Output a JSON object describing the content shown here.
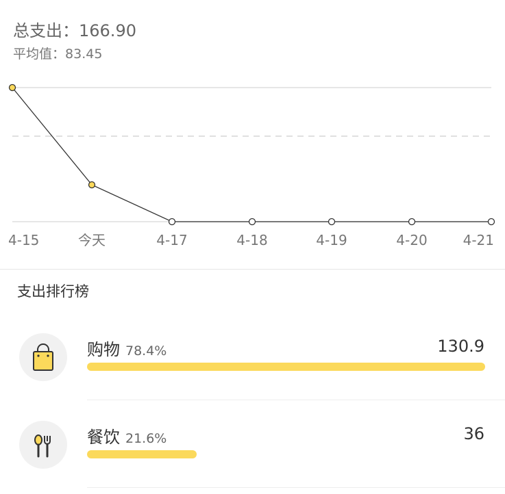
{
  "summary": {
    "total_label": "总支出：",
    "total_value": "166.90",
    "avg_label": "平均值：",
    "avg_value": "83.45"
  },
  "chart_data": {
    "type": "line",
    "categories": [
      "4-15",
      "今天",
      "4-17",
      "4-18",
      "4-19",
      "4-20",
      "4-21"
    ],
    "values": [
      130.9,
      36,
      0,
      0,
      0,
      0,
      0
    ],
    "title": "",
    "xlabel": "",
    "ylabel": "",
    "ylim": [
      0,
      130.9
    ],
    "reference_line": 83.45,
    "point_colors": {
      "spent": "#fbd95b",
      "none": "#ffffff"
    },
    "grid": "top solid, middle dashed average"
  },
  "ranking": {
    "title": "支出排行榜",
    "items": [
      {
        "name": "购物",
        "percent_text": "78.4%",
        "amount": "130.9",
        "fraction": 1.0,
        "icon": "shopping-bag-icon"
      },
      {
        "name": "餐饮",
        "percent_text": "21.6%",
        "amount": "36",
        "fraction": 0.275,
        "icon": "fork-spoon-icon"
      }
    ]
  },
  "colors": {
    "accent": "#fbd95b",
    "text": "#333333",
    "muted": "#777777"
  }
}
